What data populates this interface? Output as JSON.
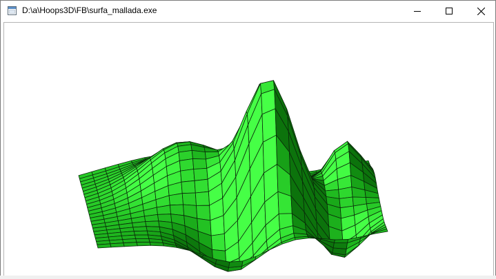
{
  "window": {
    "title": "D:\\a\\Hoops3D\\FB\\surfa_mallada.exe",
    "icon": "app-window-icon",
    "controls": {
      "minimize_icon": "minimize-icon",
      "maximize_icon": "maximize-icon",
      "close_icon": "close-icon"
    }
  },
  "viewport": {
    "content": "3D meshed surface",
    "surface_color": "#22a022",
    "mesh_line_color": "#0a2a0a",
    "background": "#ffffff"
  }
}
